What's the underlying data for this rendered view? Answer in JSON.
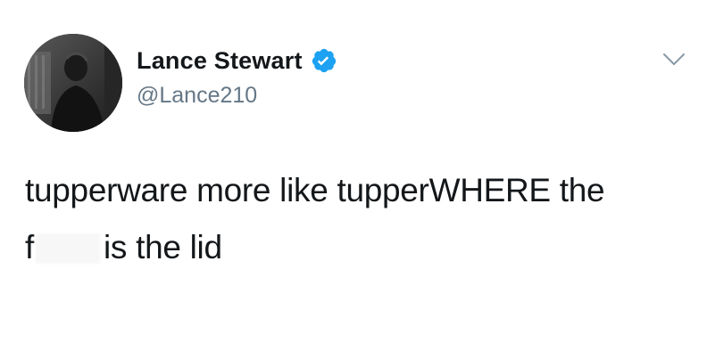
{
  "tweet": {
    "user": {
      "display_name": "Lance Stewart",
      "handle": "@Lance210",
      "verified": true,
      "avatar_icon": "profile-photo"
    },
    "menu_icon": "chevron-down-icon",
    "text": {
      "line1": "tupperware more like tupperWHERE the",
      "line2_start": "f",
      "line2_end": "is the lid"
    }
  },
  "colors": {
    "text": "#14171a",
    "handle": "#657786",
    "verified_badge": "#1da1f2",
    "background": "#ffffff"
  }
}
